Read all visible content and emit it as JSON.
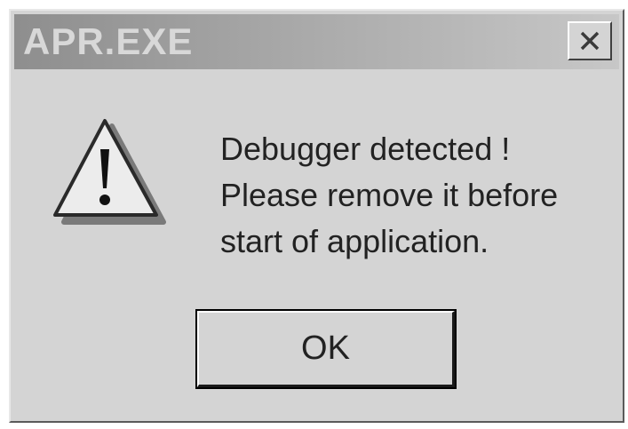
{
  "window": {
    "title": "APR.EXE",
    "close_icon": "close-icon"
  },
  "dialog": {
    "icon": "warning-icon",
    "message_lines": [
      "Debugger detected !",
      "Please remove it before",
      "start of application."
    ],
    "ok_label": "OK"
  }
}
